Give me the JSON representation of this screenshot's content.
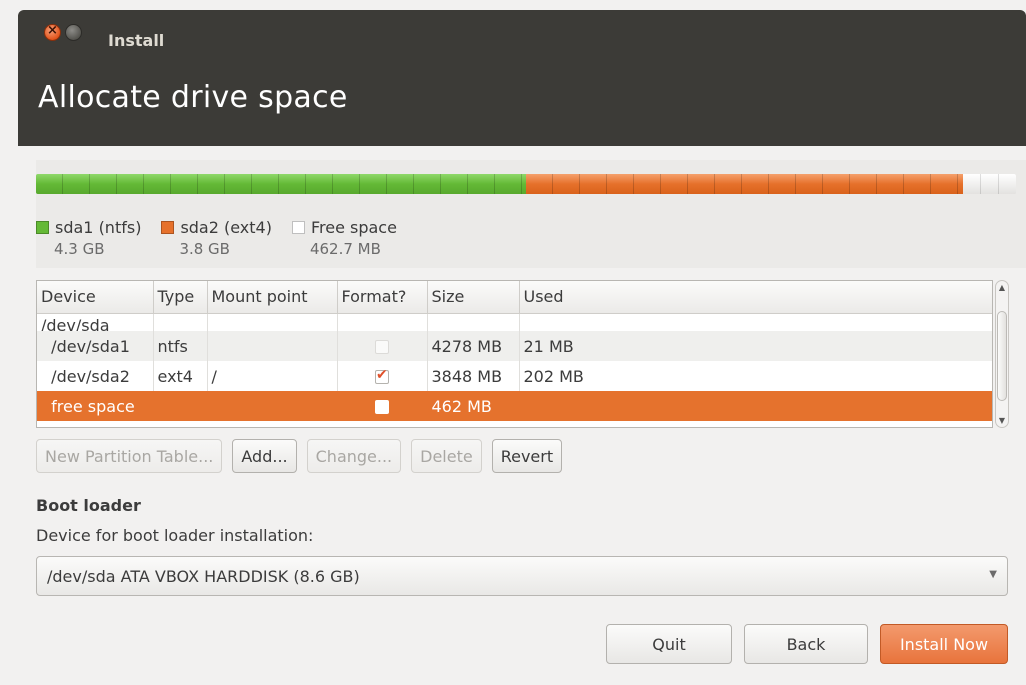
{
  "window": {
    "title": "Install",
    "close_glyph": "×"
  },
  "header": {
    "title": "Allocate drive space"
  },
  "usage": {
    "segments": [
      {
        "label": "sda1 (ntfs)",
        "size": "4.3 GB",
        "color": "#64b936",
        "fraction": 0.5
      },
      {
        "label": "sda2 (ext4)",
        "size": "3.8 GB",
        "color": "#e6712b",
        "fraction": 0.446
      },
      {
        "label": "Free space",
        "size": "462.7 MB",
        "color": "#ffffff",
        "fraction": 0.054
      }
    ]
  },
  "partitions": {
    "columns": [
      "Device",
      "Type",
      "Mount point",
      "Format?",
      "Size",
      "Used"
    ],
    "disk": "/dev/sda",
    "rows": [
      {
        "device": "/dev/sda1",
        "type": "ntfs",
        "mount": "",
        "format": "disabled",
        "size": "4278 MB",
        "used": "21 MB"
      },
      {
        "device": "/dev/sda2",
        "type": "ext4",
        "mount": "/",
        "format": "checked",
        "size": "3848 MB",
        "used": "202 MB"
      },
      {
        "device": "free space",
        "type": "",
        "mount": "",
        "format": "unchecked",
        "size": "462 MB",
        "used": ""
      }
    ],
    "selected_row": 2,
    "scrollbar": {
      "up": "▲",
      "down": "▼"
    }
  },
  "partition_buttons": {
    "new_table": "New Partition Table...",
    "add": "Add...",
    "change": "Change...",
    "delete": "Delete",
    "revert": "Revert"
  },
  "boot_loader": {
    "heading": "Boot loader",
    "label": "Device for boot loader installation:",
    "selected": "/dev/sda ATA VBOX HARDDISK (8.6 GB)",
    "arrow": "▼"
  },
  "actions": {
    "quit": "Quit",
    "back": "Back",
    "install": "Install Now"
  }
}
